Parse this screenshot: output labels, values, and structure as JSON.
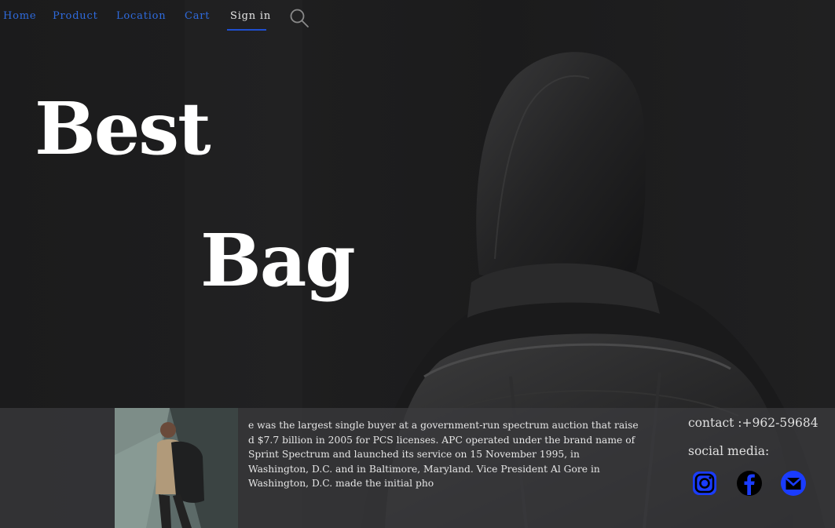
{
  "nav": {
    "items": [
      {
        "label": "Home"
      },
      {
        "label": "Product"
      },
      {
        "label": "Location"
      },
      {
        "label": "Cart"
      }
    ],
    "signin_label": "Sign in",
    "search_icon": "search-icon"
  },
  "hero": {
    "line1": "Best",
    "line2": "Bag"
  },
  "footer": {
    "body": "e was the largest single buyer at a government-run spectrum auction that raise d $7.7 billion in 2005 for PCS licenses. APC operated under the brand name of Sprint Spectrum and launched its service on 15 November 1995, in Washington, D.C. and in Baltimore, Maryland. Vice President Al Gore in Washington, D.C. made the initial pho",
    "contact": "contact :+962-59684",
    "social_label": "social media:",
    "social_icons": [
      "instagram-icon",
      "facebook-icon",
      "mail-icon"
    ]
  },
  "colors": {
    "nav_link": "#2f6bde",
    "nav_active_underline": "#1f4fd0",
    "social_icon_fill": "#1a3cff",
    "background": "#1c1c1d"
  }
}
